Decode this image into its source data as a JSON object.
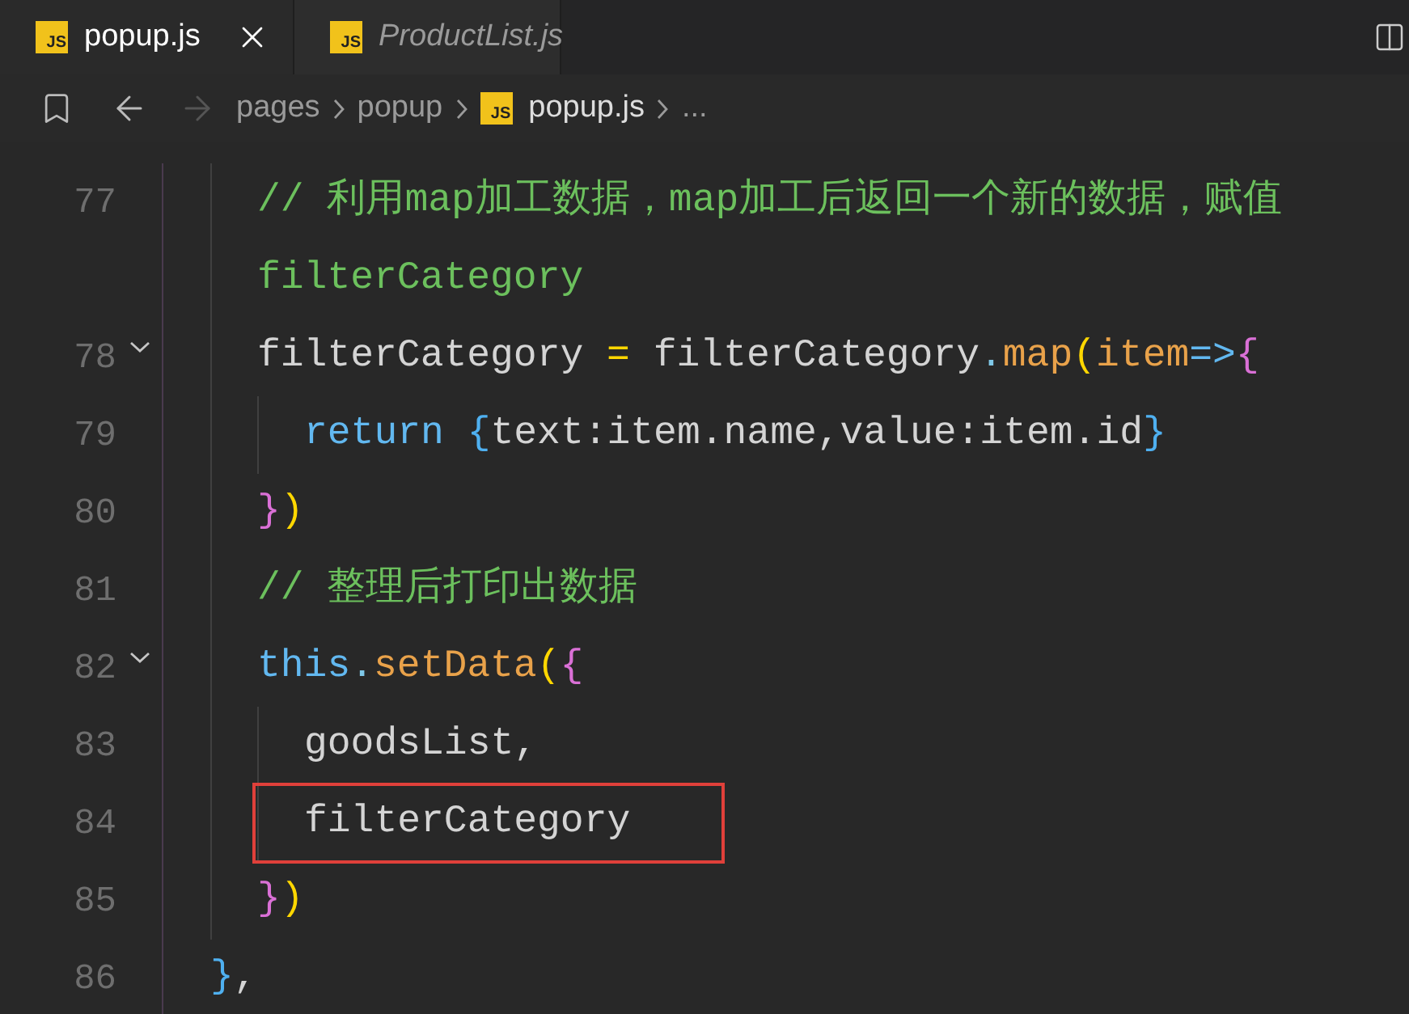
{
  "tabs": [
    {
      "icon_label": "JS",
      "label": "popup.js",
      "selected": true,
      "preview": false
    },
    {
      "icon_label": "JS",
      "label": "ProductList.js",
      "selected": false,
      "preview": true
    }
  ],
  "breadcrumb": [
    {
      "kind": "folder",
      "label": "pages"
    },
    {
      "kind": "folder",
      "label": "popup"
    },
    {
      "kind": "file",
      "icon_label": "JS",
      "label": "popup.js"
    },
    {
      "kind": "more",
      "label": "..."
    }
  ],
  "code_lines": [
    {
      "kind": "block",
      "children": [
        {
          "number": "77",
          "fold": false,
          "highlighted": false,
          "tokens": [
            {
              "color": "#6cc05d",
              "text": "// 利用map加工数据，map加工后返回一个新的数据，赋值"
            }
          ]
        },
        {
          "fold": false,
          "highlighted": false,
          "tokens": [
            {
              "color": "#6cc05d",
              "text": "filterCategory"
            }
          ]
        },
        {
          "number": "78",
          "fold": true,
          "highlighted": false,
          "tokens": [
            {
              "color": "#d4d4d4",
              "text": "filterCategory "
            },
            {
              "color": "#ffd700",
              "text": "="
            },
            {
              "color": "#d4d4d4",
              "text": " filterCategory"
            },
            {
              "color": "#7fc8e8",
              "text": "."
            },
            {
              "color": "#e9a24a",
              "text": "map"
            },
            {
              "color": "#ffd700",
              "text": "("
            },
            {
              "color": "#e9a24a",
              "text": "item"
            },
            {
              "color": "#62b8f0",
              "text": "=>"
            },
            {
              "color": "#da70d6",
              "text": "{"
            }
          ],
          "children": [
            {
              "number": "79",
              "fold": false,
              "highlighted": false,
              "tokens": [
                {
                  "color": "#62b8f0",
                  "text": "return"
                },
                {
                  "color": "#4fb0f0",
                  "text": " {"
                },
                {
                  "color": "#d4d4d4",
                  "text": "text:item.name,value:item.id"
                },
                {
                  "color": "#4fb0f0",
                  "text": "}"
                }
              ]
            }
          ]
        },
        {
          "number": "80",
          "fold": false,
          "highlighted": false,
          "tokens": [
            {
              "color": "#da70d6",
              "text": "}"
            },
            {
              "color": "#ffd700",
              "text": ")"
            }
          ]
        },
        {
          "number": "81",
          "fold": false,
          "highlighted": false,
          "tokens": [
            {
              "color": "#6cc05d",
              "text": "// 整理后打印出数据"
            }
          ]
        },
        {
          "number": "82",
          "fold": true,
          "highlighted": false,
          "tokens": [
            {
              "color": "#62b8f0",
              "text": "this"
            },
            {
              "color": "#7fc8e8",
              "text": "."
            },
            {
              "color": "#e9a24a",
              "text": "setData"
            },
            {
              "color": "#ffd700",
              "text": "("
            },
            {
              "color": "#da70d6",
              "text": "{"
            }
          ],
          "children": [
            {
              "number": "83",
              "fold": false,
              "highlighted": false,
              "tokens": [
                {
                  "color": "#d4d4d4",
                  "text": "goodsList,"
                }
              ]
            },
            {
              "number": "84",
              "fold": false,
              "highlighted": true,
              "tokens": [
                {
                  "color": "#d4d4d4",
                  "text": "filterCategory"
                }
              ]
            }
          ]
        },
        {
          "number": "85",
          "fold": false,
          "highlighted": false,
          "tokens": [
            {
              "color": "#da70d6",
              "text": "}"
            },
            {
              "color": "#ffd700",
              "text": ")"
            }
          ]
        }
      ]
    },
    {
      "number": "86",
      "fold": false,
      "highlighted": false,
      "tokens": [
        {
          "color": "#4fb0f0",
          "text": "}"
        },
        {
          "color": "#d4d4d4",
          "text": ","
        }
      ]
    }
  ]
}
